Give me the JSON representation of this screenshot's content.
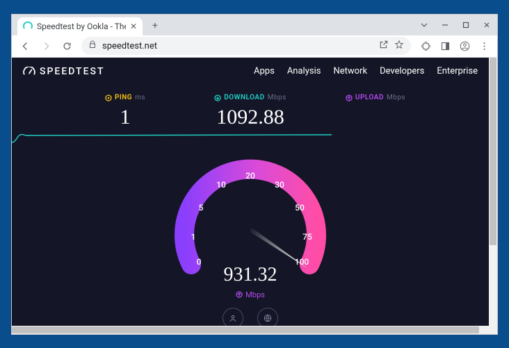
{
  "browser": {
    "tab_title": "Speedtest by Ookla - The Global",
    "url": "speedtest.net",
    "win": {
      "dropdown": "⌄",
      "min": "—",
      "max": "☐",
      "close": "✕"
    }
  },
  "header": {
    "logo_text": "SPEEDTEST",
    "nav": [
      "Apps",
      "Analysis",
      "Network",
      "Developers",
      "Enterprise"
    ]
  },
  "metrics": {
    "ping": {
      "label": "PING",
      "unit": "ms",
      "value": "1"
    },
    "download": {
      "label": "DOWNLOAD",
      "unit": "Mbps",
      "value": "1092.88"
    },
    "upload": {
      "label": "UPLOAD",
      "unit": "Mbps",
      "value": ""
    }
  },
  "gauge": {
    "value": "931.32",
    "unit": "Mbps",
    "ticks": [
      "0",
      "1",
      "5",
      "10",
      "20",
      "30",
      "50",
      "75",
      "100"
    ]
  },
  "chart_data": {
    "type": "gauge",
    "title": "Speedtest",
    "series": [
      {
        "name": "Ping",
        "unit": "ms",
        "value": 1
      },
      {
        "name": "Download",
        "unit": "Mbps",
        "value": 1092.88
      },
      {
        "name": "Upload",
        "unit": "Mbps",
        "value": null
      }
    ],
    "gauge": {
      "current": 931.32,
      "unit": "Mbps",
      "ticks": [
        0,
        1,
        5,
        10,
        20,
        30,
        50,
        75,
        100
      ],
      "range": [
        0,
        100
      ]
    }
  }
}
